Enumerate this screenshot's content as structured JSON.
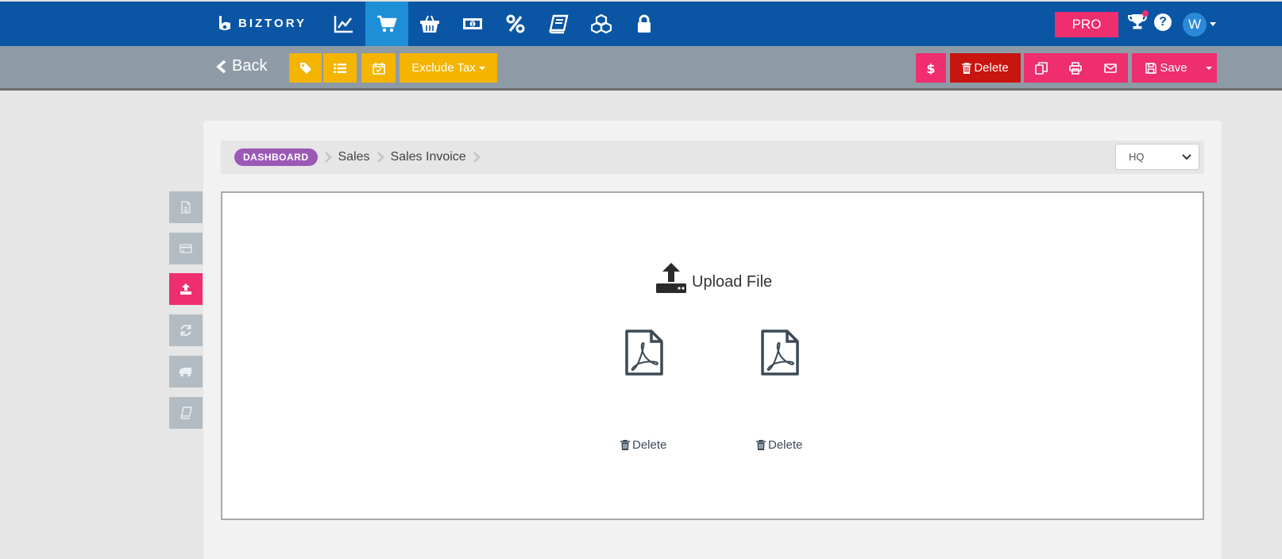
{
  "app": {
    "logo_text": "BIZTORY"
  },
  "nav": {
    "icons": [
      "chart-line-icon",
      "cart-icon",
      "basket-icon",
      "money-icon",
      "percent-icon",
      "book-icon",
      "cubes-icon",
      "lock-icon"
    ],
    "active": "cart-icon"
  },
  "header": {
    "pro_label": "PRO",
    "help_label": "?",
    "avatar_initial": "W"
  },
  "toolbar": {
    "back_label": "Back",
    "exclude_tax_label": "Exclude Tax",
    "delete_label": "Delete",
    "save_label": "Save"
  },
  "breadcrumb": {
    "dashboard": "DASHBOARD",
    "items": [
      "Sales",
      "Sales Invoice"
    ]
  },
  "branch": {
    "selected": "HQ"
  },
  "upload": {
    "label": "Upload File"
  },
  "files": [
    {
      "type": "pdf",
      "delete_label": "Delete"
    },
    {
      "type": "pdf",
      "delete_label": "Delete"
    }
  ],
  "colors": {
    "nav": "#0a56a5",
    "active_nav": "#1e8fd6",
    "accent_pink": "#ee2e6e",
    "accent_yellow": "#f4b400",
    "danger": "#c8150f",
    "badge": "#9b59b6"
  }
}
